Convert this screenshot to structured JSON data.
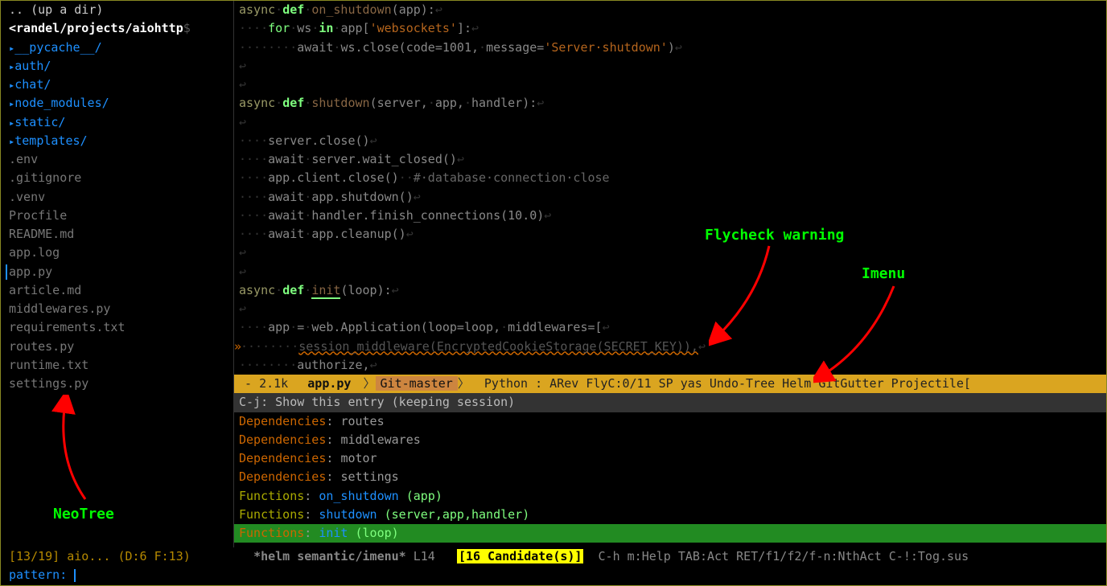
{
  "sidebar": {
    "up": ".. (up a dir)",
    "cwd": "<randel/projects/aiohttp",
    "prompt": "$",
    "dirs": [
      "__pycache__/",
      "auth/",
      "chat/",
      "node_modules/",
      "static/",
      "templates/"
    ],
    "files": [
      ".env",
      ".gitignore",
      ".venv",
      "Procfile",
      "README.md",
      "app.log",
      "app.py",
      "article.md",
      "middlewares.py",
      "requirements.txt",
      "routes.py",
      "runtime.txt",
      "settings.py"
    ],
    "current_index": 6,
    "status_left": "[13/19] aio... (D:6 F:13)"
  },
  "code": {
    "lines": [
      {
        "t": "async·def·on_shutdown(app):↩",
        "parts": [
          [
            "kw-async",
            "async"
          ],
          [
            "ws",
            "·"
          ],
          [
            "kw-def",
            "def"
          ],
          [
            "ws",
            "·"
          ],
          [
            "fname",
            "on_shutdown"
          ],
          [
            "paren",
            "("
          ],
          [
            "var",
            "app"
          ],
          [
            "paren",
            "):"
          ],
          [
            "eol",
            "↩"
          ]
        ]
      },
      {
        "t": "",
        "parts": [
          [
            "ws",
            "····"
          ],
          [
            "kw-for",
            "for"
          ],
          [
            "ws",
            "·"
          ],
          [
            "var",
            "ws"
          ],
          [
            "ws",
            "·"
          ],
          [
            "kw-in",
            "in"
          ],
          [
            "ws",
            "·"
          ],
          [
            "var",
            "app["
          ],
          [
            "str",
            "'websockets'"
          ],
          [
            "var",
            "]:"
          ],
          [
            "eol",
            "↩"
          ]
        ]
      },
      {
        "t": "",
        "parts": [
          [
            "ws",
            "········"
          ],
          [
            "var",
            "await"
          ],
          [
            "ws",
            "·"
          ],
          [
            "var",
            "ws.close(code=1001,"
          ],
          [
            "ws",
            "·"
          ],
          [
            "var",
            "message="
          ],
          [
            "str",
            "'Server·shutdown'"
          ],
          [
            "var",
            ")"
          ],
          [
            "eol",
            "↩"
          ]
        ]
      },
      {
        "t": "",
        "parts": [
          [
            "eol",
            "↩"
          ]
        ]
      },
      {
        "t": "",
        "parts": [
          [
            "eol",
            "↩"
          ]
        ]
      },
      {
        "t": "",
        "parts": [
          [
            "kw-async",
            "async"
          ],
          [
            "ws",
            "·"
          ],
          [
            "kw-def",
            "def"
          ],
          [
            "ws",
            "·"
          ],
          [
            "fname",
            "shutdown"
          ],
          [
            "paren",
            "("
          ],
          [
            "var",
            "server,"
          ],
          [
            "ws",
            "·"
          ],
          [
            "var",
            "app,"
          ],
          [
            "ws",
            "·"
          ],
          [
            "var",
            "handler"
          ],
          [
            "paren",
            "):"
          ],
          [
            "eol",
            "↩"
          ]
        ]
      },
      {
        "t": "",
        "parts": [
          [
            "eol",
            "↩"
          ]
        ]
      },
      {
        "t": "",
        "parts": [
          [
            "ws",
            "····"
          ],
          [
            "var",
            "server.close()"
          ],
          [
            "eol",
            "↩"
          ]
        ]
      },
      {
        "t": "",
        "parts": [
          [
            "ws",
            "····"
          ],
          [
            "var",
            "await"
          ],
          [
            "ws",
            "·"
          ],
          [
            "var",
            "server.wait_closed()"
          ],
          [
            "eol",
            "↩"
          ]
        ]
      },
      {
        "t": "",
        "parts": [
          [
            "ws",
            "····"
          ],
          [
            "var",
            "app.client.close()"
          ],
          [
            "ws",
            "··"
          ],
          [
            "comment",
            "#·database·connection·close"
          ]
        ]
      },
      {
        "t": "",
        "parts": [
          [
            "ws",
            "····"
          ],
          [
            "var",
            "await"
          ],
          [
            "ws",
            "·"
          ],
          [
            "var",
            "app.shutdown()"
          ],
          [
            "eol",
            "↩"
          ]
        ]
      },
      {
        "t": "",
        "parts": [
          [
            "ws",
            "····"
          ],
          [
            "var",
            "await"
          ],
          [
            "ws",
            "·"
          ],
          [
            "var",
            "handler.finish_connections(10.0)"
          ],
          [
            "eol",
            "↩"
          ]
        ]
      },
      {
        "t": "",
        "parts": [
          [
            "ws",
            "····"
          ],
          [
            "var",
            "await"
          ],
          [
            "ws",
            "·"
          ],
          [
            "var",
            "app.cleanup()"
          ],
          [
            "eol",
            "↩"
          ]
        ]
      },
      {
        "t": "",
        "parts": [
          [
            "eol",
            "↩"
          ]
        ]
      },
      {
        "t": "",
        "parts": [
          [
            "eol",
            "↩"
          ]
        ]
      },
      {
        "t": "",
        "parts": [
          [
            "kw-async",
            "async"
          ],
          [
            "ws",
            "·"
          ],
          [
            "kw-def",
            "def"
          ],
          [
            "ws",
            "·"
          ],
          [
            "fname",
            "init",
            "cursor"
          ],
          [
            "paren",
            "("
          ],
          [
            "var",
            "loop"
          ],
          [
            "paren",
            "):"
          ],
          [
            "eol",
            "↩"
          ]
        ]
      },
      {
        "t": "",
        "parts": [
          [
            "eol",
            "↩"
          ]
        ]
      },
      {
        "t": "",
        "parts": [
          [
            "ws",
            "····"
          ],
          [
            "var",
            "app"
          ],
          [
            "ws",
            "·"
          ],
          [
            "var",
            "="
          ],
          [
            "ws",
            "·"
          ],
          [
            "var",
            "web.Application(loop=loop,"
          ],
          [
            "ws",
            "·"
          ],
          [
            "var",
            "middlewares=["
          ],
          [
            "eol",
            "↩"
          ]
        ]
      },
      {
        "t": "",
        "parts": [
          [
            "ws",
            "········"
          ],
          [
            "squiggle",
            "session_middleware(EncryptedCookieStorage(SECRET_KEY)),"
          ],
          [
            "eol",
            "↩"
          ]
        ],
        "warn": true
      },
      {
        "t": "",
        "parts": [
          [
            "ws",
            "········"
          ],
          [
            "var",
            "authorize,"
          ],
          [
            "eol",
            "↩"
          ]
        ]
      }
    ]
  },
  "modeline": {
    "left": " - 2.1k  ",
    "fname": "app.py",
    "git": "Git-master",
    "right": "  Python : ARev FlyC:0/11 SP yas Undo-Tree Helm GitGutter Projectile["
  },
  "helm": {
    "header": "C-j: Show this entry (keeping session)",
    "rows": [
      {
        "group": "Dependencies",
        "name": "routes",
        "args": ""
      },
      {
        "group": "Dependencies",
        "name": "middlewares",
        "args": ""
      },
      {
        "group": "Dependencies",
        "name": "motor",
        "args": ""
      },
      {
        "group": "Dependencies",
        "name": "settings",
        "args": ""
      },
      {
        "group": "Functions",
        "name": "on_shutdown",
        "args": "(app)"
      },
      {
        "group": "Functions",
        "name": "shutdown",
        "args": "(server,app,handler)"
      },
      {
        "group": "Functions",
        "name": "init",
        "args": "(loop)",
        "selected": true
      }
    ]
  },
  "bottom": {
    "buf": "*helm semantic/imenu*",
    "pos": " L14",
    "cand": "[16 Candidate(s)]",
    "hint": "  C-h m:Help TAB:Act RET/f1/f2/f-n:NthAct C-!:Tog.sus"
  },
  "pattern": {
    "label": "pattern: "
  },
  "annotations": {
    "neotree": "NeoTree",
    "flycheck": "Flycheck warning",
    "imenu": "Imenu"
  }
}
